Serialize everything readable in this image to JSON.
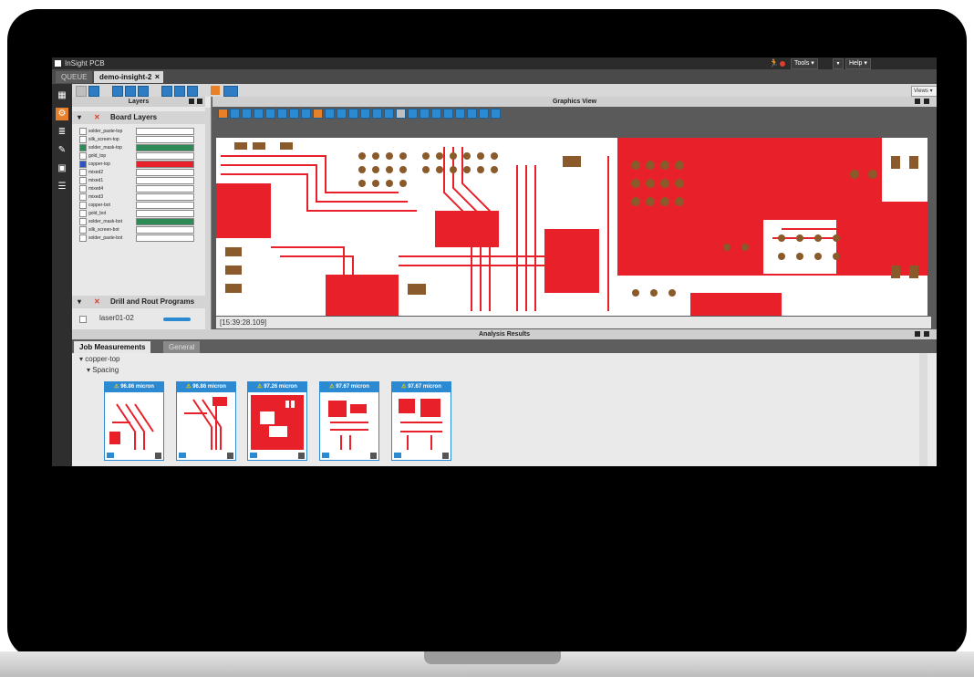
{
  "app": {
    "title": "InSight PCB"
  },
  "menus": {
    "tools": "Tools",
    "help": "Help"
  },
  "tabs": {
    "queue": "QUEUE",
    "active": "demo-insight-2",
    "close": "×"
  },
  "toolbar": {
    "views": "Views"
  },
  "layers_panel": {
    "title": "Layers",
    "board_layers_title": "Board Layers",
    "layers": [
      {
        "name": "solder_paste-top",
        "checked": false
      },
      {
        "name": "silk_screen-top",
        "checked": false
      },
      {
        "name": "solder_mask-top",
        "checked": true
      },
      {
        "name": "gold_top",
        "checked": false
      },
      {
        "name": "copper-top",
        "checked": true
      },
      {
        "name": "mixed2",
        "checked": false
      },
      {
        "name": "mixed1",
        "checked": false
      },
      {
        "name": "mixed4",
        "checked": false
      },
      {
        "name": "mixed3",
        "checked": false
      },
      {
        "name": "copper-bot",
        "checked": false
      },
      {
        "name": "gold_bot",
        "checked": false
      },
      {
        "name": "solder_mask-bot",
        "checked": false
      },
      {
        "name": "silk_screen-bot",
        "checked": false
      },
      {
        "name": "solder_paste-bot",
        "checked": false
      }
    ],
    "drill_title": "Drill and Rout Programs",
    "drill_item": "laser01-02"
  },
  "graphics": {
    "title": "Graphics View",
    "timestamp": "[15:39:28.109]"
  },
  "analysis": {
    "title": "Analysis Results",
    "tab_active": "Job Measurements",
    "tab_general": "General",
    "tree_layer": "copper-top",
    "tree_category": "Spacing",
    "results": [
      {
        "label": "96.86 micron"
      },
      {
        "label": "96.86 micron"
      },
      {
        "label": "97.26 micron"
      },
      {
        "label": "97.67 micron"
      },
      {
        "label": "97.67 micron"
      }
    ]
  },
  "colors": {
    "copper": "#e8202a",
    "pad": "#8a5a2b",
    "accent": "#2b8ad2",
    "tool_orange": "#e8802a"
  }
}
